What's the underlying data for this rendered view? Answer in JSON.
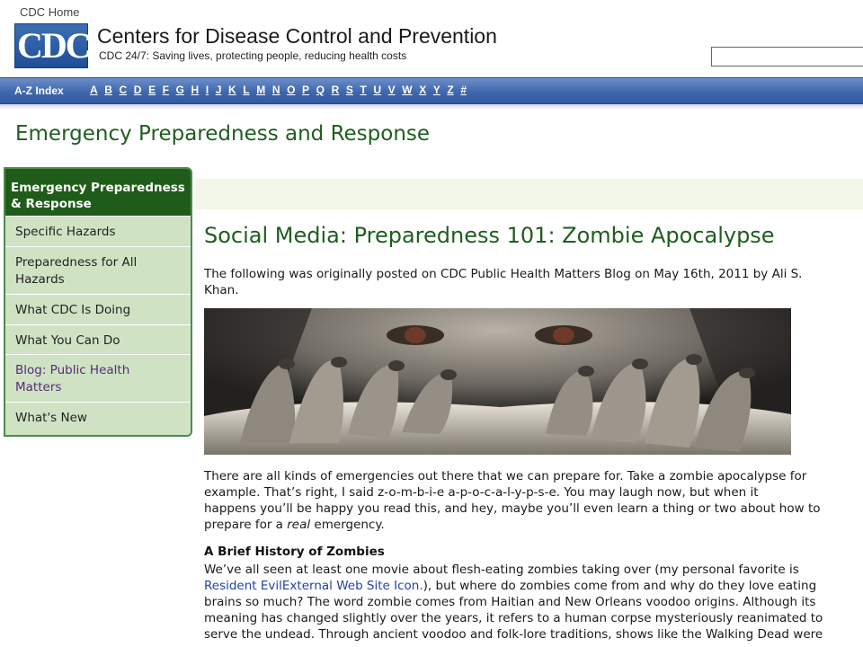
{
  "header": {
    "home_link": "CDC Home",
    "logo_text": "CDC",
    "agency_name": "Centers for Disease Control and Prevention",
    "tagline": "CDC 24/7: Saving lives, protecting people, reducing health costs",
    "search": {
      "value": "",
      "placeholder": ""
    }
  },
  "az_bar": {
    "label": "A-Z Index",
    "letters": [
      "A",
      "B",
      "C",
      "D",
      "E",
      "F",
      "G",
      "H",
      "I",
      "J",
      "K",
      "L",
      "M",
      "N",
      "O",
      "P",
      "Q",
      "R",
      "S",
      "T",
      "U",
      "V",
      "W",
      "X",
      "Y",
      "Z",
      "#"
    ]
  },
  "section_title": "Emergency Preparedness and Response",
  "left_nav": {
    "header_line1": "Emergency Preparedness",
    "header_line2": "& Response",
    "items": [
      {
        "lines": [
          "Specific Hazards"
        ]
      },
      {
        "lines": [
          "Preparedness for All",
          "Hazards"
        ]
      },
      {
        "lines": [
          "What CDC Is Doing"
        ]
      },
      {
        "lines": [
          "What You Can Do"
        ]
      },
      {
        "lines": [
          "Blog: Public Health",
          "Matters"
        ]
      },
      {
        "lines": [
          "What's New"
        ]
      }
    ]
  },
  "article": {
    "title": "Social Media: Preparedness 101: Zombie Apocalypse",
    "byline_1": "The following was originally posted on CDC Public Health Matters Blog on May 16th, 2011 by Ali S.",
    "byline_2": "Khan.",
    "p1_l1": "There are all kinds of emergencies out there that we can prepare for. Take a zombie apocalypse for",
    "p1_l2": "example. That’s right, I said z-o-m-b-i-e a-p-o-c-a-l-y-p-s-e. You may laugh now, but when it",
    "p1_l3": "happens you’ll be happy you read this, and hey, maybe you’ll even learn a thing or two about how to",
    "p1_l4a": "prepare for a ",
    "p1_l4_em": "real",
    "p1_l4b": " emergency.",
    "subhead": "A Brief History of Zombies",
    "p2_l1": "We’ve all seen at least one movie about flesh-eating zombies taking over (my personal favorite is",
    "p2_link": "Resident EvilExternal Web Site Icon.",
    "p2_l2b": "), but where do zombies come from and why do they love eating",
    "p2_l3": "brains so much? The word zombie comes from Haitian and New Orleans voodoo origins. Although its",
    "p2_l4": "meaning has changed slightly over the years, it refers to a human corpse mysteriously reanimated to",
    "p2_l5": "serve the undead. Through ancient voodoo and folk-lore traditions, shows like the Walking Dead were"
  }
}
